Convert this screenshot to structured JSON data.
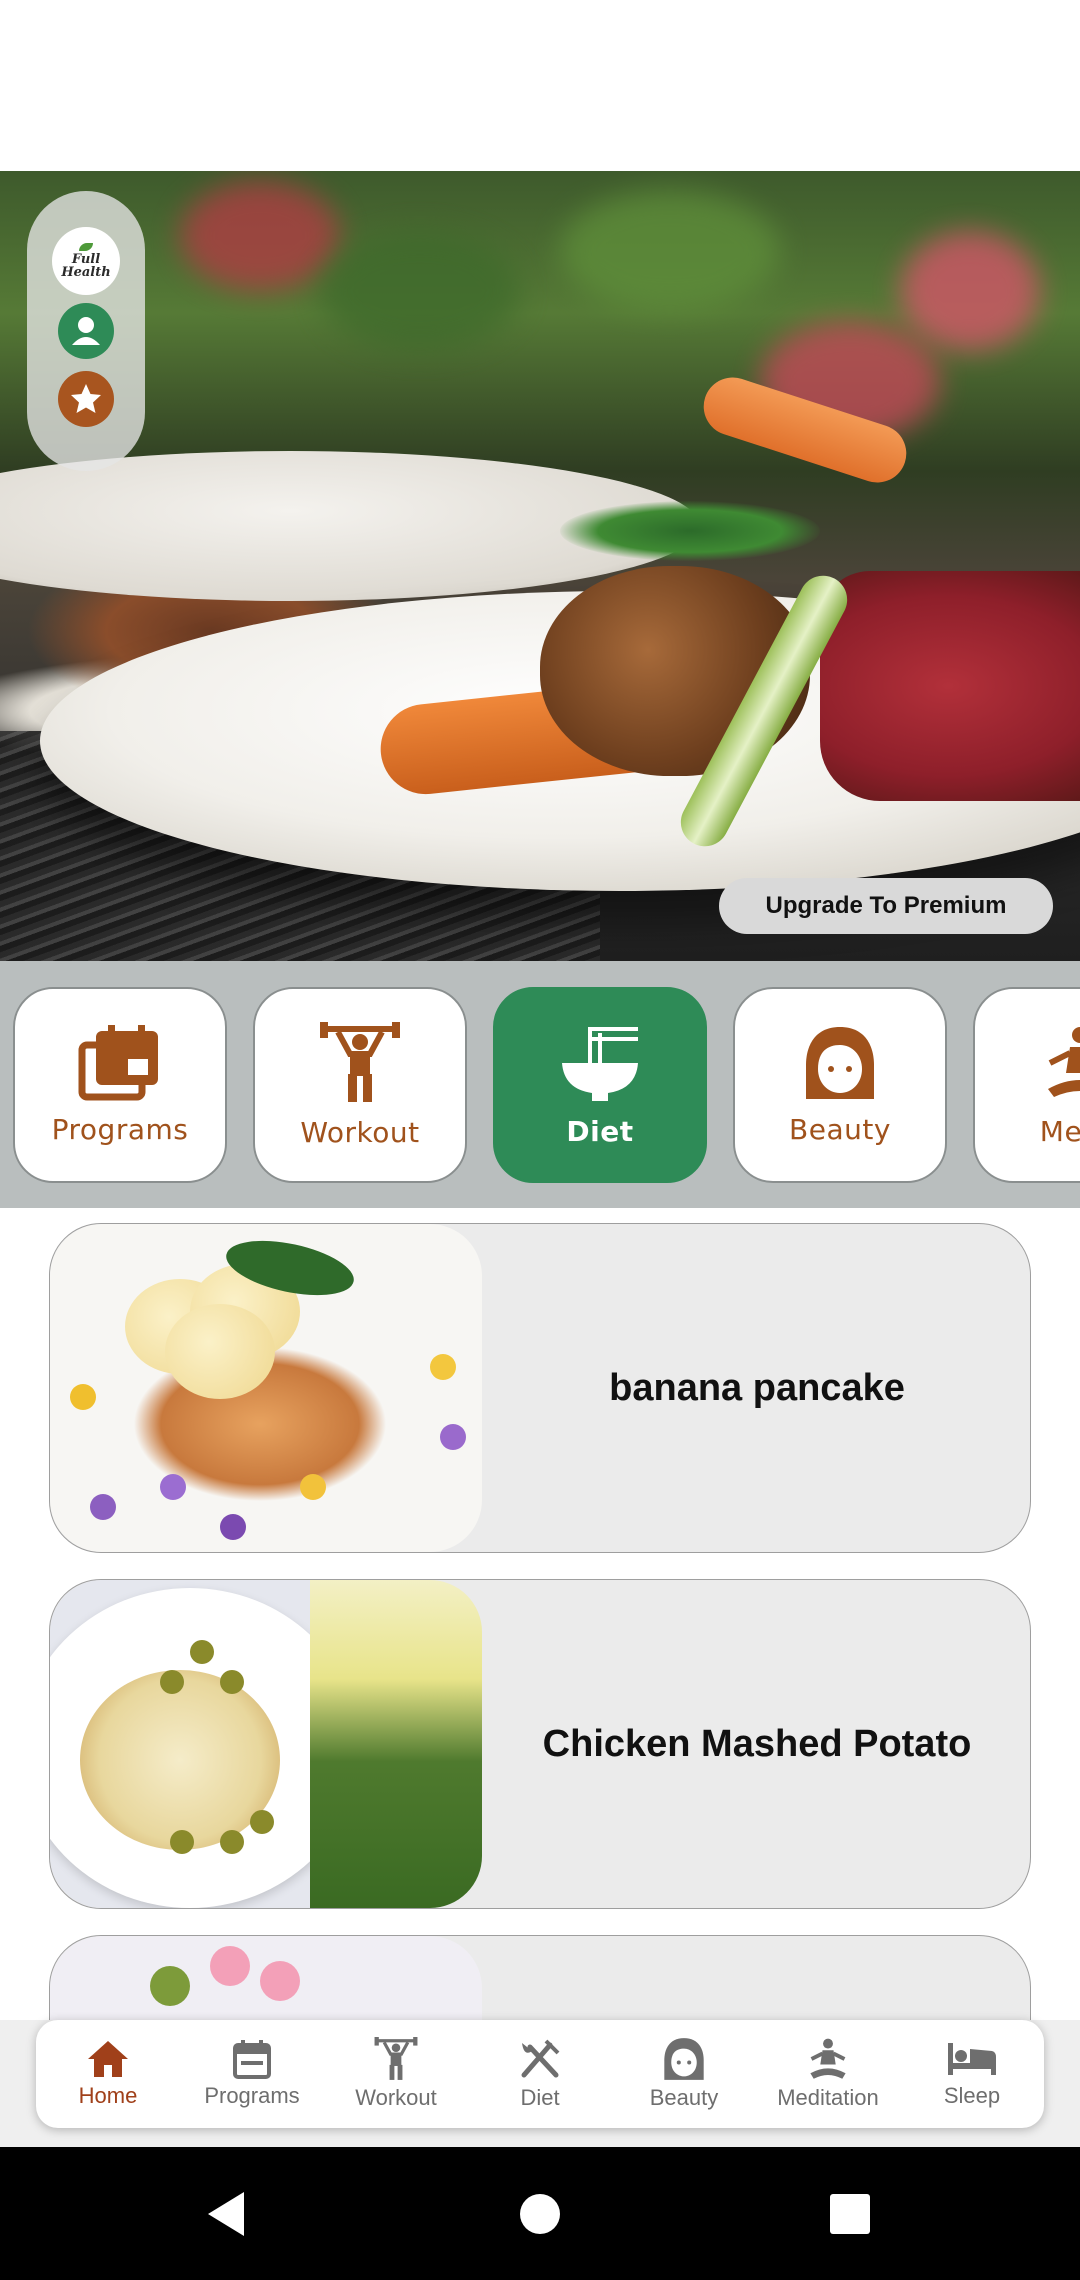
{
  "hero": {
    "logo_text": "Full Health",
    "upgrade_label": "Upgrade To Premium"
  },
  "categories": [
    {
      "label": "Programs",
      "icon": "calendar-icon",
      "active": false
    },
    {
      "label": "Workout",
      "icon": "weightlifter-icon",
      "active": false
    },
    {
      "label": "Diet",
      "icon": "noodle-bowl-icon",
      "active": true
    },
    {
      "label": "Beauty",
      "icon": "woman-face-icon",
      "active": false
    },
    {
      "label": "Medit",
      "icon": "meditation-icon",
      "active": false
    }
  ],
  "recipes": [
    {
      "title": "banana pancake"
    },
    {
      "title": "Chicken Mashed Potato"
    },
    {
      "title": ""
    }
  ],
  "bottom_nav": [
    {
      "label": "Home",
      "icon": "home-icon",
      "active": true
    },
    {
      "label": "Programs",
      "icon": "calendar-icon",
      "active": false
    },
    {
      "label": "Workout",
      "icon": "weightlifter-icon",
      "active": false
    },
    {
      "label": "Diet",
      "icon": "fork-knife-icon",
      "active": false
    },
    {
      "label": "Beauty",
      "icon": "woman-face-icon",
      "active": false
    },
    {
      "label": "Meditation",
      "icon": "meditation-icon",
      "active": false
    },
    {
      "label": "Sleep",
      "icon": "bed-icon",
      "active": false
    }
  ],
  "colors": {
    "accent_green": "#2e8b57",
    "accent_brown": "#a0521c",
    "nav_active": "#a0401a"
  }
}
